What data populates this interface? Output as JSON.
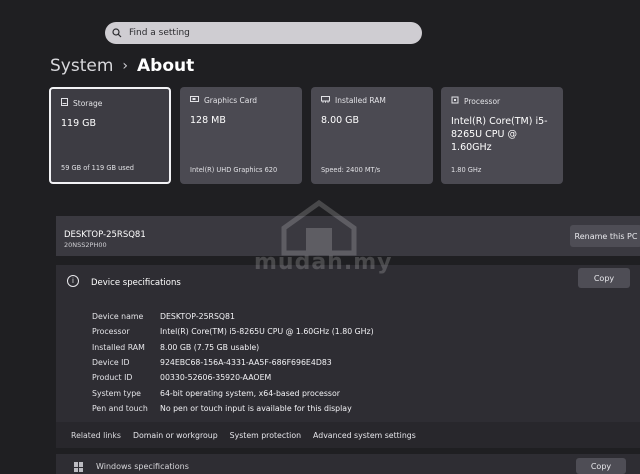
{
  "search": {
    "placeholder": "Find a setting"
  },
  "breadcrumb": {
    "parent": "System",
    "separator": "›",
    "current": "About"
  },
  "cards": [
    {
      "icon": "storage-icon",
      "label": "Storage",
      "value": "119 GB",
      "sub": "59 GB of 119 GB used",
      "selected": true
    },
    {
      "icon": "graphics-card-icon",
      "label": "Graphics Card",
      "value": "128 MB",
      "sub": "Intel(R) UHD Graphics 620"
    },
    {
      "icon": "ram-icon",
      "label": "Installed RAM",
      "value": "8.00 GB",
      "sub": "Speed: 2400 MT/s"
    },
    {
      "icon": "processor-icon",
      "label": "Processor",
      "value": "Intel(R) Core(TM) i5-8265U CPU @ 1.60GHz",
      "sub": "1.80 GHz"
    }
  ],
  "device": {
    "name": "DESKTOP-25RSQ81",
    "model": "20NSS2PH00",
    "rename_label": "Rename this PC"
  },
  "specs": {
    "title": "Device specifications",
    "copy_label": "Copy",
    "rows": [
      {
        "key": "Device name",
        "value": "DESKTOP-25RSQ81"
      },
      {
        "key": "Processor",
        "value": "Intel(R) Core(TM) i5-8265U CPU @ 1.60GHz (1.80 GHz)"
      },
      {
        "key": "Installed RAM",
        "value": "8.00 GB (7.75 GB usable)"
      },
      {
        "key": "Device ID",
        "value": "924EBC68-156A-4331-AA5F-686F696E4D83"
      },
      {
        "key": "Product ID",
        "value": "00330-52606-35920-AAOEM"
      },
      {
        "key": "System type",
        "value": "64-bit operating system, x64-based processor"
      },
      {
        "key": "Pen and touch",
        "value": "No pen or touch input is available for this display"
      }
    ]
  },
  "related": {
    "label": "Related links",
    "links": [
      "Domain or workgroup",
      "System protection",
      "Advanced system settings"
    ]
  },
  "windows_spec": {
    "title": "Windows specifications",
    "copy_label": "Copy"
  },
  "watermark": "mudah.my"
}
